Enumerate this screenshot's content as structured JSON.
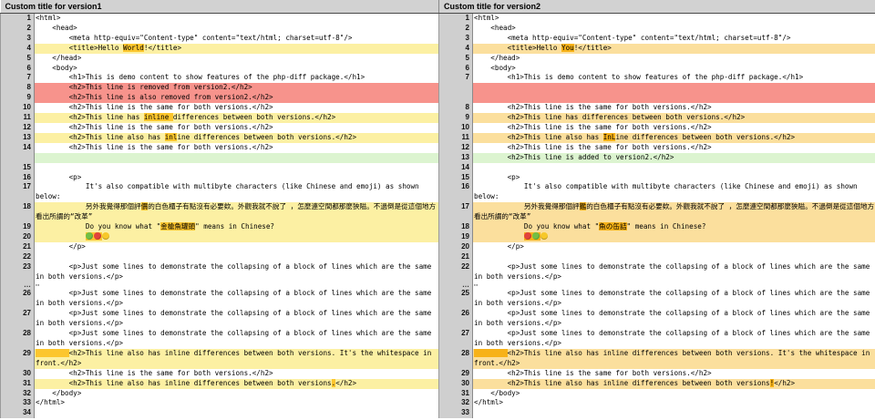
{
  "header": {
    "left_title": "Custom title for version1",
    "right_title": "Custom title for version2"
  },
  "colors": {
    "removed_bg": "#f7938c",
    "added_bg": "#dcf4d0",
    "changed_old_bg": "#fcf0a3",
    "changed_new_bg": "#fbdf9d",
    "inline_highlight_old": "#fcc62e",
    "inline_highlight_new": "#f7b218",
    "gutter_bg": "#cfcfcf",
    "header_bg": "#d2d2d2"
  },
  "rows": [
    {
      "l": {
        "n": "1",
        "t": "same",
        "s": [
          [
            "<html>",
            0
          ]
        ]
      },
      "r": {
        "n": "1",
        "t": "same",
        "s": [
          [
            "<html>",
            0
          ]
        ]
      }
    },
    {
      "l": {
        "n": "2",
        "t": "same",
        "s": [
          [
            "    <head>",
            0
          ]
        ]
      },
      "r": {
        "n": "2",
        "t": "same",
        "s": [
          [
            "    <head>",
            0
          ]
        ]
      }
    },
    {
      "l": {
        "n": "3",
        "t": "same",
        "s": [
          [
            "        <meta http-equiv=\"Content-type\" content=\"text/html; charset=utf-8\"/>",
            0
          ]
        ]
      },
      "r": {
        "n": "3",
        "t": "same",
        "s": [
          [
            "        <meta http-equiv=\"Content-type\" content=\"text/html; charset=utf-8\"/>",
            0
          ]
        ]
      }
    },
    {
      "l": {
        "n": "4",
        "t": "chg",
        "s": [
          [
            "        <title>Hello ",
            0
          ],
          [
            "World",
            1
          ],
          [
            "!</title>",
            0
          ]
        ]
      },
      "r": {
        "n": "4",
        "t": "chg",
        "s": [
          [
            "        <title>Hello ",
            0
          ],
          [
            "You",
            1
          ],
          [
            "!</title>",
            0
          ]
        ]
      }
    },
    {
      "l": {
        "n": "5",
        "t": "same",
        "s": [
          [
            "    </head>",
            0
          ]
        ]
      },
      "r": {
        "n": "5",
        "t": "same",
        "s": [
          [
            "    </head>",
            0
          ]
        ]
      }
    },
    {
      "l": {
        "n": "6",
        "t": "same",
        "s": [
          [
            "    <body>",
            0
          ]
        ]
      },
      "r": {
        "n": "6",
        "t": "same",
        "s": [
          [
            "    <body>",
            0
          ]
        ]
      }
    },
    {
      "l": {
        "n": "7",
        "t": "same",
        "s": [
          [
            "        <h1>This is demo content to show features of the php-diff package.</h1>",
            0
          ]
        ]
      },
      "r": {
        "n": "7",
        "t": "same",
        "s": [
          [
            "        <h1>This is demo content to show features of the php-diff package.</h1>",
            0
          ]
        ]
      }
    },
    {
      "l": {
        "n": "8",
        "t": "del",
        "s": [
          [
            "        <h2>This line is removed from version2.</h2>",
            0
          ]
        ]
      },
      "r": {
        "n": "",
        "t": "emptydel",
        "s": []
      }
    },
    {
      "l": {
        "n": "9",
        "t": "del",
        "s": [
          [
            "        <h2>This line is also removed from version2.</h2>",
            0
          ]
        ]
      },
      "r": {
        "n": "",
        "t": "emptydel",
        "s": []
      }
    },
    {
      "l": {
        "n": "10",
        "t": "same",
        "s": [
          [
            "        <h2>This line is the same for both versions.</h2>",
            0
          ]
        ]
      },
      "r": {
        "n": "8",
        "t": "same",
        "s": [
          [
            "        <h2>This line is the same for both versions.</h2>",
            0
          ]
        ]
      }
    },
    {
      "l": {
        "n": "11",
        "t": "chg",
        "s": [
          [
            "        <h2>This line has ",
            0
          ],
          [
            "inline ",
            1
          ],
          [
            "differences between both versions.</h2>",
            0
          ]
        ]
      },
      "r": {
        "n": "9",
        "t": "chg",
        "s": [
          [
            "        <h2>This line has differences between both versions.</h2>",
            0
          ]
        ]
      }
    },
    {
      "l": {
        "n": "12",
        "t": "same",
        "s": [
          [
            "        <h2>This line is the same for both versions.</h2>",
            0
          ]
        ]
      },
      "r": {
        "n": "10",
        "t": "same",
        "s": [
          [
            "        <h2>This line is the same for both versions.</h2>",
            0
          ]
        ]
      }
    },
    {
      "l": {
        "n": "13",
        "t": "chg",
        "s": [
          [
            "        <h2>This line also has ",
            0
          ],
          [
            "inl",
            1
          ],
          [
            "ine differences between both versions.</h2>",
            0
          ]
        ]
      },
      "r": {
        "n": "11",
        "t": "chg",
        "s": [
          [
            "        <h2>This line also has ",
            0
          ],
          [
            "InL",
            1
          ],
          [
            "ine differences between both versions.</h2>",
            0
          ]
        ]
      }
    },
    {
      "l": {
        "n": "14",
        "t": "same",
        "s": [
          [
            "        <h2>This line is the same for both versions.</h2>",
            0
          ]
        ]
      },
      "r": {
        "n": "12",
        "t": "same",
        "s": [
          [
            "        <h2>This line is the same for both versions.</h2>",
            0
          ]
        ]
      }
    },
    {
      "l": {
        "n": "",
        "t": "emptyins",
        "s": []
      },
      "r": {
        "n": "13",
        "t": "ins",
        "s": [
          [
            "        <h2>This line is added to version2.</h2>",
            0
          ]
        ]
      }
    },
    {
      "l": {
        "n": "15",
        "t": "empty",
        "s": []
      },
      "r": {
        "n": "14",
        "t": "empty",
        "s": []
      }
    },
    {
      "l": {
        "n": "16",
        "t": "same",
        "s": [
          [
            "        <p>",
            0
          ]
        ]
      },
      "r": {
        "n": "15",
        "t": "same",
        "s": [
          [
            "        <p>",
            0
          ]
        ]
      }
    },
    {
      "l": {
        "n": "17",
        "t": "same",
        "s": [
          [
            "            It's also compatible with multibyte characters (like Chinese and emoji) as shown below:",
            0
          ]
        ]
      },
      "r": {
        "n": "16",
        "t": "same",
        "s": [
          [
            "            It's also compatible with multibyte characters (like Chinese and emoji) as shown below:",
            0
          ]
        ]
      }
    },
    {
      "l": {
        "n": "18",
        "t": "chg",
        "s": [
          [
            "            另外我覺得那個評",
            0
          ],
          [
            "價",
            1
          ],
          [
            "的白色櫃子有點沒有必要欸。外觀我就不說了 ，怎麼連空間都那麼狹隘。不過倒是從這個地方看出所謂的“改革”",
            0
          ]
        ]
      },
      "r": {
        "n": "17",
        "t": "chg",
        "s": [
          [
            "            另外我覺得那個評",
            0
          ],
          [
            "鑑",
            1
          ],
          [
            "的白色櫃子有點沒有必要欸。外觀我就不說了 ，怎麼連空間都那麼狹隘。不過倒是從這個地方看出所謂的“改革”",
            0
          ]
        ]
      }
    },
    {
      "l": {
        "n": "19",
        "t": "chg",
        "s": [
          [
            "            Do you know what \"",
            0
          ],
          [
            "金槍魚罐頭",
            1
          ],
          [
            "\" means in Chinese?",
            0
          ]
        ]
      },
      "r": {
        "n": "18",
        "t": "chg",
        "s": [
          [
            "            Do you know what \"",
            0
          ],
          [
            "魚の缶詰",
            1
          ],
          [
            "\" means in Chinese?",
            0
          ]
        ]
      }
    },
    {
      "l": {
        "n": "20",
        "t": "chg",
        "s": [
          [
            "            ",
            0
          ],
          [
            "🍏🍎",
            1
          ],
          [
            "☺",
            0
          ]
        ]
      },
      "r": {
        "n": "19",
        "t": "chg",
        "s": [
          [
            "            ",
            0
          ],
          [
            "🍎🍏",
            1
          ],
          [
            "☺",
            0
          ]
        ]
      }
    },
    {
      "l": {
        "n": "21",
        "t": "same",
        "s": [
          [
            "        </p>",
            0
          ]
        ]
      },
      "r": {
        "n": "20",
        "t": "same",
        "s": [
          [
            "        </p>",
            0
          ]
        ]
      }
    },
    {
      "l": {
        "n": "22",
        "t": "empty",
        "s": []
      },
      "r": {
        "n": "21",
        "t": "empty",
        "s": []
      }
    },
    {
      "l": {
        "n": "23",
        "t": "same",
        "s": [
          [
            "        <p>Just some lines to demonstrate the collapsing of a block of lines which are the same in both versions.</p>",
            0
          ]
        ]
      },
      "r": {
        "n": "22",
        "t": "same",
        "s": [
          [
            "        <p>Just some lines to demonstrate the collapsing of a block of lines which are the same in both versions.</p>",
            0
          ]
        ]
      }
    },
    {
      "l": {
        "n": "…",
        "t": "skip",
        "s": [
          [
            "⋯",
            0
          ]
        ]
      },
      "r": {
        "n": "…",
        "t": "skip",
        "s": [
          [
            "⋯",
            0
          ]
        ]
      }
    },
    {
      "l": {
        "n": "26",
        "t": "same",
        "s": [
          [
            "        <p>Just some lines to demonstrate the collapsing of a block of lines which are the same in both versions.</p>",
            0
          ]
        ]
      },
      "r": {
        "n": "25",
        "t": "same",
        "s": [
          [
            "        <p>Just some lines to demonstrate the collapsing of a block of lines which are the same in both versions.</p>",
            0
          ]
        ]
      }
    },
    {
      "l": {
        "n": "27",
        "t": "same",
        "s": [
          [
            "        <p>Just some lines to demonstrate the collapsing of a block of lines which are the same in both versions.</p>",
            0
          ]
        ]
      },
      "r": {
        "n": "26",
        "t": "same",
        "s": [
          [
            "        <p>Just some lines to demonstrate the collapsing of a block of lines which are the same in both versions.</p>",
            0
          ]
        ]
      }
    },
    {
      "l": {
        "n": "28",
        "t": "same",
        "s": [
          [
            "        <p>Just some lines to demonstrate the collapsing of a block of lines which are the same in both versions.</p>",
            0
          ]
        ]
      },
      "r": {
        "n": "27",
        "t": "same",
        "s": [
          [
            "        <p>Just some lines to demonstrate the collapsing of a block of lines which are the same in both versions.</p>",
            0
          ]
        ]
      }
    },
    {
      "l": {
        "n": "29",
        "t": "chg",
        "s": [
          [
            "\t",
            1
          ],
          [
            "<h2>This line also has inline differences between both versions. It's the whitespace in front.</h2>",
            0
          ]
        ]
      },
      "r": {
        "n": "28",
        "t": "chg",
        "s": [
          [
            "        ",
            1
          ],
          [
            "<h2>This line also has inline differences between both versions. It's the whitespace in front.</h2>",
            0
          ]
        ]
      }
    },
    {
      "l": {
        "n": "30",
        "t": "same",
        "s": [
          [
            "        <h2>This line is the same for both versions.</h2>",
            0
          ]
        ]
      },
      "r": {
        "n": "29",
        "t": "same",
        "s": [
          [
            "        <h2>This line is the same for both versions.</h2>",
            0
          ]
        ]
      }
    },
    {
      "l": {
        "n": "31",
        "t": "chg",
        "s": [
          [
            "        <h2>This line also has inline differences between both versions",
            0
          ],
          [
            ".",
            1
          ],
          [
            "</h2>",
            0
          ]
        ]
      },
      "r": {
        "n": "30",
        "t": "chg",
        "s": [
          [
            "        <h2>This line also has inline differences between both versions",
            0
          ],
          [
            "!",
            1
          ],
          [
            "</h2>",
            0
          ]
        ]
      }
    },
    {
      "l": {
        "n": "32",
        "t": "same",
        "s": [
          [
            "    </body>",
            0
          ]
        ]
      },
      "r": {
        "n": "31",
        "t": "same",
        "s": [
          [
            "    </body>",
            0
          ]
        ]
      }
    },
    {
      "l": {
        "n": "33",
        "t": "same",
        "s": [
          [
            "</html>",
            0
          ]
        ]
      },
      "r": {
        "n": "32",
        "t": "same",
        "s": [
          [
            "</html>",
            0
          ]
        ]
      }
    },
    {
      "l": {
        "n": "34",
        "t": "empty",
        "s": []
      },
      "r": {
        "n": "33",
        "t": "empty",
        "s": []
      }
    }
  ]
}
